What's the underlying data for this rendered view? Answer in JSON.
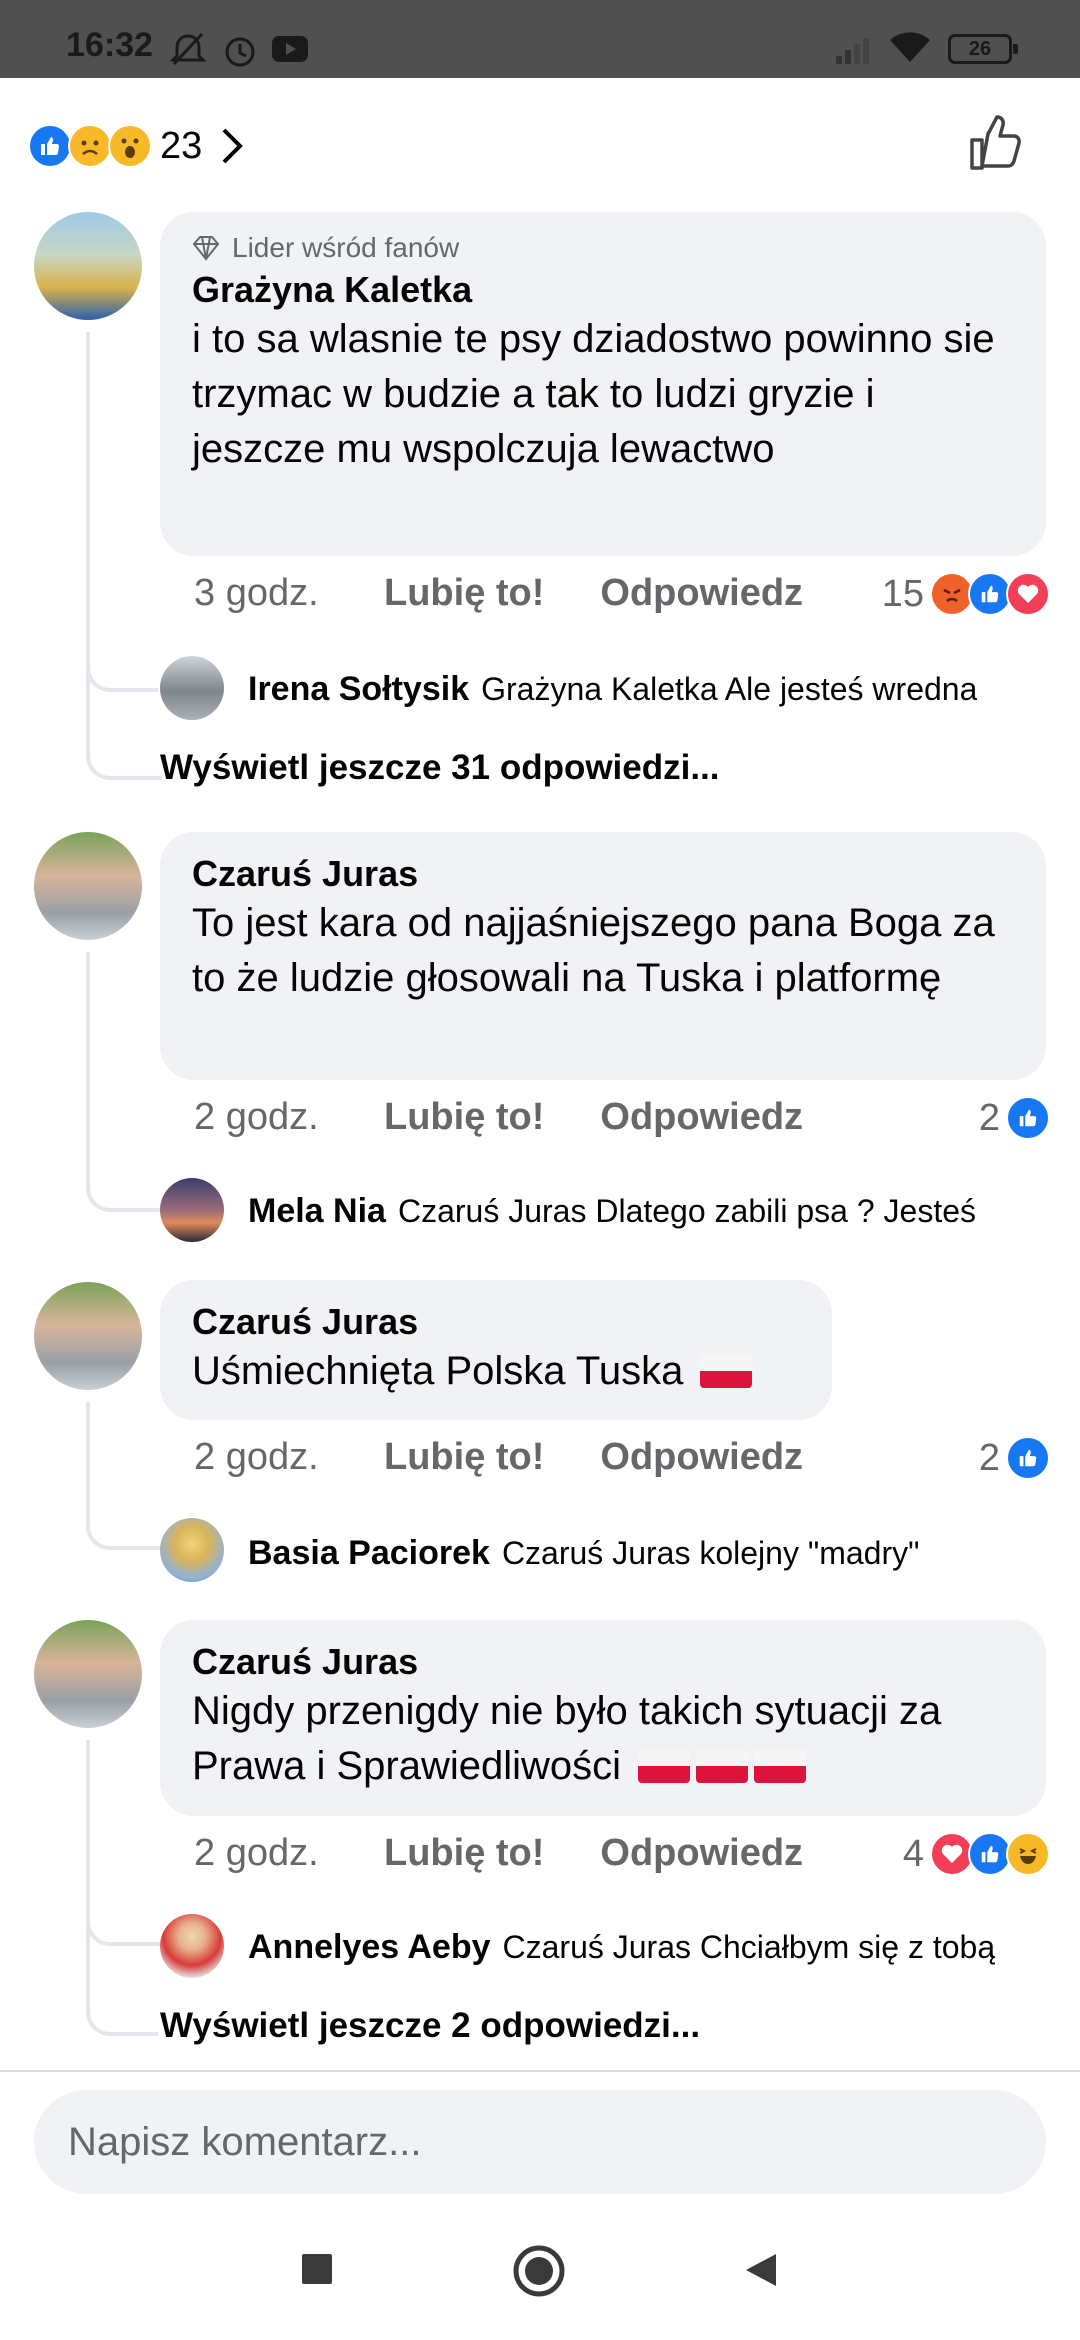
{
  "status_bar": {
    "time": "16:32",
    "battery": "26"
  },
  "header": {
    "reaction_count": "23"
  },
  "comments": [
    {
      "badge": "Lider wśród fanów",
      "author": "Grażyna Kaletka",
      "text": "i to sa wlasnie te psy dziadostwo powinno sie trzymac w budzie a tak to ludzi gryzie i jeszcze mu wspolczuja lewactwo",
      "time": "3 godz.",
      "like_label": "Lubię to!",
      "reply_label": "Odpowiedz",
      "reaction_count": "15",
      "reply": {
        "author": "Irena Sołtysik",
        "text": "Grażyna Kaletka Ale jesteś wredna"
      },
      "more_replies": "Wyświetl jeszcze 31 odpowiedzi..."
    },
    {
      "author": "Czaruś Juras",
      "text": "To jest kara od najjaśniejszego pana Boga za to że ludzie głosowali na Tuska i platformę",
      "time": "2 godz.",
      "like_label": "Lubię to!",
      "reply_label": "Odpowiedz",
      "reaction_count": "2",
      "reply": {
        "author": "Mela Nia",
        "text": "Czaruś Juras Dlatego zabili psa ? Jesteś"
      }
    },
    {
      "author": "Czaruś Juras",
      "text": "Uśmiechnięta Polska Tuska",
      "time": "2 godz.",
      "like_label": "Lubię to!",
      "reply_label": "Odpowiedz",
      "reaction_count": "2",
      "reply": {
        "author": "Basia Paciorek",
        "text": "Czaruś Juras kolejny \"madry\""
      }
    },
    {
      "author": "Czaruś Juras",
      "text": "Nigdy przenigdy nie było takich sytuacji za Prawa i Sprawiedliwości",
      "time": "2 godz.",
      "like_label": "Lubię to!",
      "reply_label": "Odpowiedz",
      "reaction_count": "4",
      "reply": {
        "author": "Annelyes Aeby",
        "text": "Czaruś Juras Chciałbym się z tobą"
      },
      "more_replies": "Wyświetl jeszcze 2 odpowiedzi..."
    }
  ],
  "composer": {
    "placeholder": "Napisz komentarz..."
  },
  "colors": {
    "like_blue": "#1877f2",
    "love_red": "#f33e58",
    "haha_yellow": "#f7b928",
    "bubble": "#f0f2f5",
    "meta_gray": "#65676b"
  }
}
